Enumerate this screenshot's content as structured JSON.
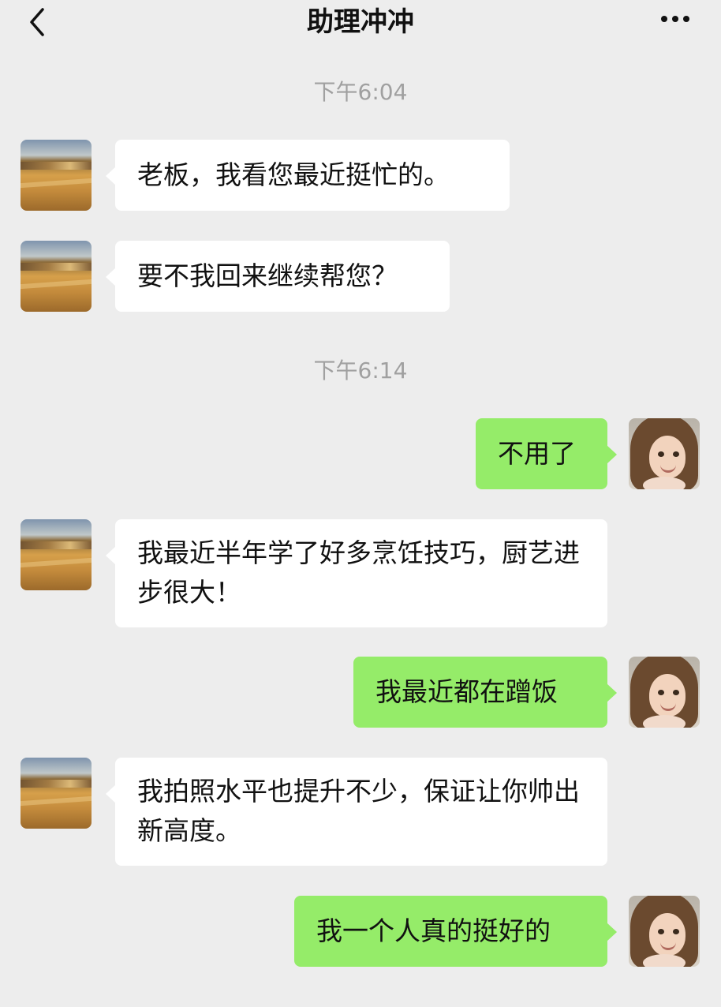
{
  "header": {
    "title": "助理冲冲",
    "back_icon": "chevron-left-icon",
    "more_icon": "more-dots-icon"
  },
  "timestamps": [
    "下午6:04",
    "下午6:14"
  ],
  "messages": [
    {
      "side": "left",
      "text": "老板，我看您最近挺忙的。"
    },
    {
      "side": "left",
      "text": "要不我回来继续帮您？"
    },
    {
      "side": "right",
      "text": "不用了"
    },
    {
      "side": "left",
      "text": "我最近半年学了好多烹饪技巧，厨艺进步很大！"
    },
    {
      "side": "right",
      "text": "我最近都在蹭饭"
    },
    {
      "side": "left",
      "text": "我拍照水平也提升不少，保证让你帅出新高度。"
    },
    {
      "side": "right",
      "text": "我一个人真的挺好的"
    }
  ],
  "colors": {
    "background": "#ededed",
    "left_bubble": "#ffffff",
    "right_bubble": "#95ec69",
    "timestamp": "#a0a0a0"
  }
}
